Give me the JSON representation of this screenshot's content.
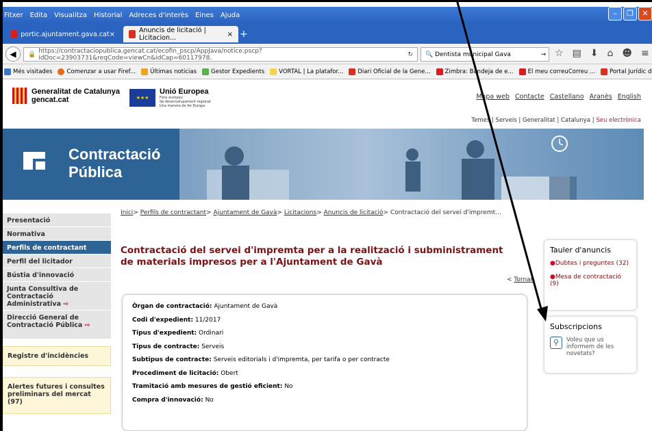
{
  "menubar": [
    "Fitxer",
    "Edita",
    "Visualitza",
    "Historial",
    "Adreces d'interès",
    "Eines",
    "Ajuda"
  ],
  "tabs": [
    {
      "label": "portic.ajuntament.gava.cat",
      "close": "×",
      "fav_color": "#d81e1e"
    },
    {
      "label": "Anuncis de licitació | Licitacion...",
      "close": "×",
      "fav_color": "#d7321e"
    }
  ],
  "newtab": "+",
  "navbar": {
    "url": "https://contractaciopublica.gencat.cat/ecofin_pscp/AppJava/notice.pscp?idDoc=23903731&reqCode=viewCn&idCap=60117978.",
    "search": "Dentista municipal Gava"
  },
  "bookmarks": [
    {
      "label": "Més visitades",
      "color": "#3a77c8"
    },
    {
      "label": "Comenzar a usar Firef...",
      "color": "#e66a1c"
    },
    {
      "label": "Últimas noticias",
      "color": "#f0a31c"
    },
    {
      "label": "Gestor Expedients",
      "color": "#5ab04a"
    },
    {
      "label": "VORTAL | La platafor...",
      "color": "#f7d54b"
    },
    {
      "label": "Diari Oficial de la Gene...",
      "color": "#d7321e"
    },
    {
      "label": "Zimbra: Bandeja de e...",
      "color": "#d81e1e"
    },
    {
      "label": "El meu correuCorreu ...",
      "color": "#d81e1e"
    },
    {
      "label": "Portal Jurídic de Catal...",
      "color": "#d7321e"
    }
  ],
  "header": {
    "gen_line1": "Generalitat de Catalunya",
    "gen_line2": "gencat.cat",
    "ue_title": "Unió Europea",
    "ue_sub1": "Fons europeu",
    "ue_sub2": "de desenvolupament regional",
    "ue_sub3": "Una manera de fer Europa",
    "eu_flag": "★★★",
    "toplinks": [
      "Mapa web",
      "Contacte",
      "Castellano",
      "Aranès",
      "English"
    ],
    "subtop": "Temes | Serveis | Generalitat | Catalunya |",
    "subtop_red": "Seu electrònica"
  },
  "banner": {
    "line1": "Contractació",
    "line2": "Pública"
  },
  "sidebar": {
    "items": [
      {
        "label": "Presentació"
      },
      {
        "label": "Normativa"
      },
      {
        "label": "Perfils de contractant"
      },
      {
        "label": "Perfil del licitador"
      },
      {
        "label": "Bústia d'innovació"
      },
      {
        "label": "Junta Consultiva de Contractació Administrativa"
      },
      {
        "label": "Direcció General de Contractació Pública"
      }
    ],
    "ext_icon": "⇨",
    "registre": "Registre d'incidències",
    "alertes": "Alertes futures i consultes preliminars del mercat (97)"
  },
  "breadcrumb": {
    "items": [
      "Inici",
      "Perfils de contractant",
      "Ajuntament de Gavà",
      "Licitacions",
      "Anuncis de licitació"
    ],
    "current": "Contractació del servei d'impremt...",
    "sep": ">"
  },
  "title": "Contractació del servei d'impremta per a la realització i subministrament de materials impresos per a l'Ajuntament de Gavà",
  "tornar": {
    "prefix": "<",
    "label": "Tornar"
  },
  "details": [
    {
      "k": "Òrgan de contractació:",
      "v": "Ajuntament de Gavà"
    },
    {
      "k": "Codi d'expedient:",
      "v": "11/2017"
    },
    {
      "k": "Tipus d'expedient:",
      "v": "Ordinari"
    },
    {
      "k": "Tipus de contracte:",
      "v": "Serveis"
    },
    {
      "k": "Subtipus de contracte:",
      "v": "Serveis editorials i d'impremta, per tarifa o per contracte"
    },
    {
      "k": "Procediment de licitació:",
      "v": "Obert"
    },
    {
      "k": "Tramitació amb mesures de gestió eficient:",
      "v": "No"
    },
    {
      "k": "Compra d'innovació:",
      "v": "No"
    }
  ],
  "tauler": {
    "title": "Tauler d'anuncis",
    "links": [
      "Dubtes i preguntes (32)",
      "Mesa de contractació (9)"
    ]
  },
  "subscripcions": {
    "title": "Subscripcions",
    "text": "Voleu que us informem de les novetats?"
  },
  "colors": {
    "brand_blue": "#2e6396",
    "title_red": "#7b1214",
    "accent_red": "#c8102e"
  }
}
